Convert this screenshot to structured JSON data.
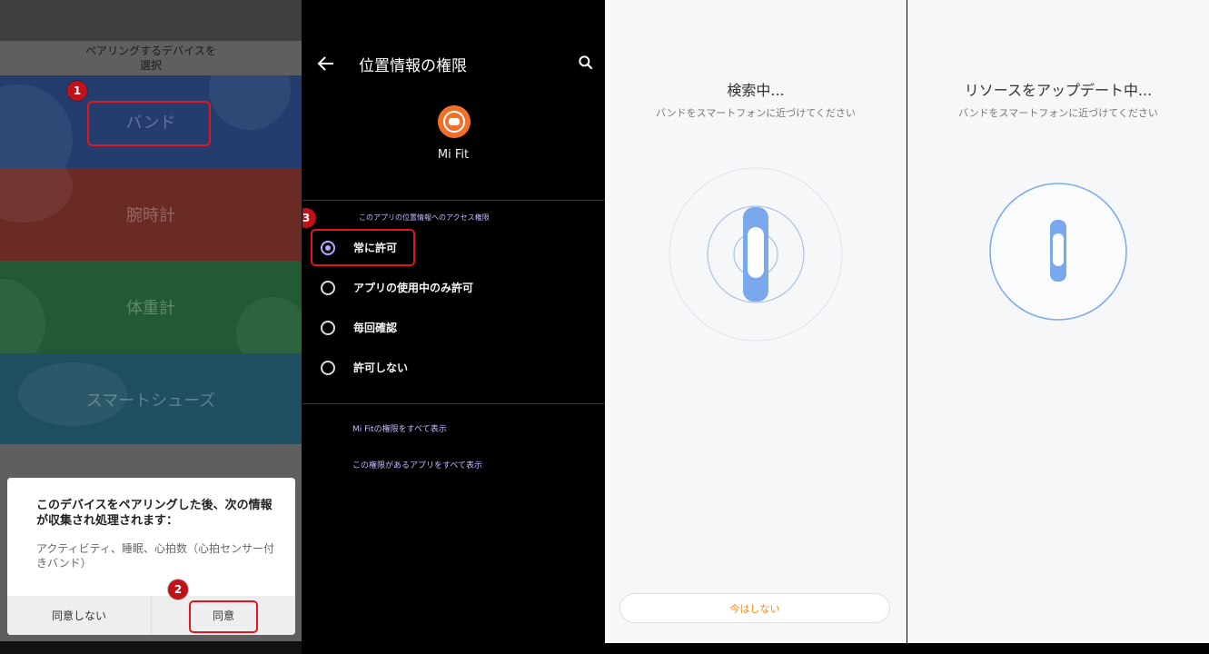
{
  "panel1": {
    "header_line1": "ペアリングするデバイスを",
    "header_line2": "選択",
    "categories": [
      {
        "label": "バンド"
      },
      {
        "label": "腕時計"
      },
      {
        "label": "体重計"
      },
      {
        "label": "スマートシューズ"
      }
    ],
    "dialog": {
      "title": "このデバイスをペアリングした後、次の情報が収集され処理されます：",
      "body": "アクティビティ、睡眠、心拍数（心拍センサー付きバンド）",
      "decline": "同意しない",
      "agree": "同意"
    },
    "markers": [
      "1",
      "2"
    ]
  },
  "panel2": {
    "title": "位置情報の権限",
    "app_name": "Mi Fit",
    "section_label": "このアプリの位置情報へのアクセス権限",
    "options": [
      {
        "label": "常に許可",
        "selected": true
      },
      {
        "label": "アプリの使用中のみ許可",
        "selected": false
      },
      {
        "label": "毎回確認",
        "selected": false
      },
      {
        "label": "許可しない",
        "selected": false
      }
    ],
    "link_all_permissions": "Mi Fitの権限をすべて表示",
    "link_all_apps": "この権限があるアプリをすべて表示",
    "marker": "3"
  },
  "panel3": {
    "heading": "検索中...",
    "subtext": "バンドをスマートフォンに近づけてください",
    "button": "今はしない"
  },
  "panel4": {
    "heading": "リソースをアップデート中...",
    "subtext": "バンドをスマートフォンに近づけてください"
  },
  "colors": {
    "accent_purple": "#b9a7ff",
    "marker_red": "#c0121b",
    "band_blue": "#7aa8ec",
    "orange": "#f28a18"
  }
}
